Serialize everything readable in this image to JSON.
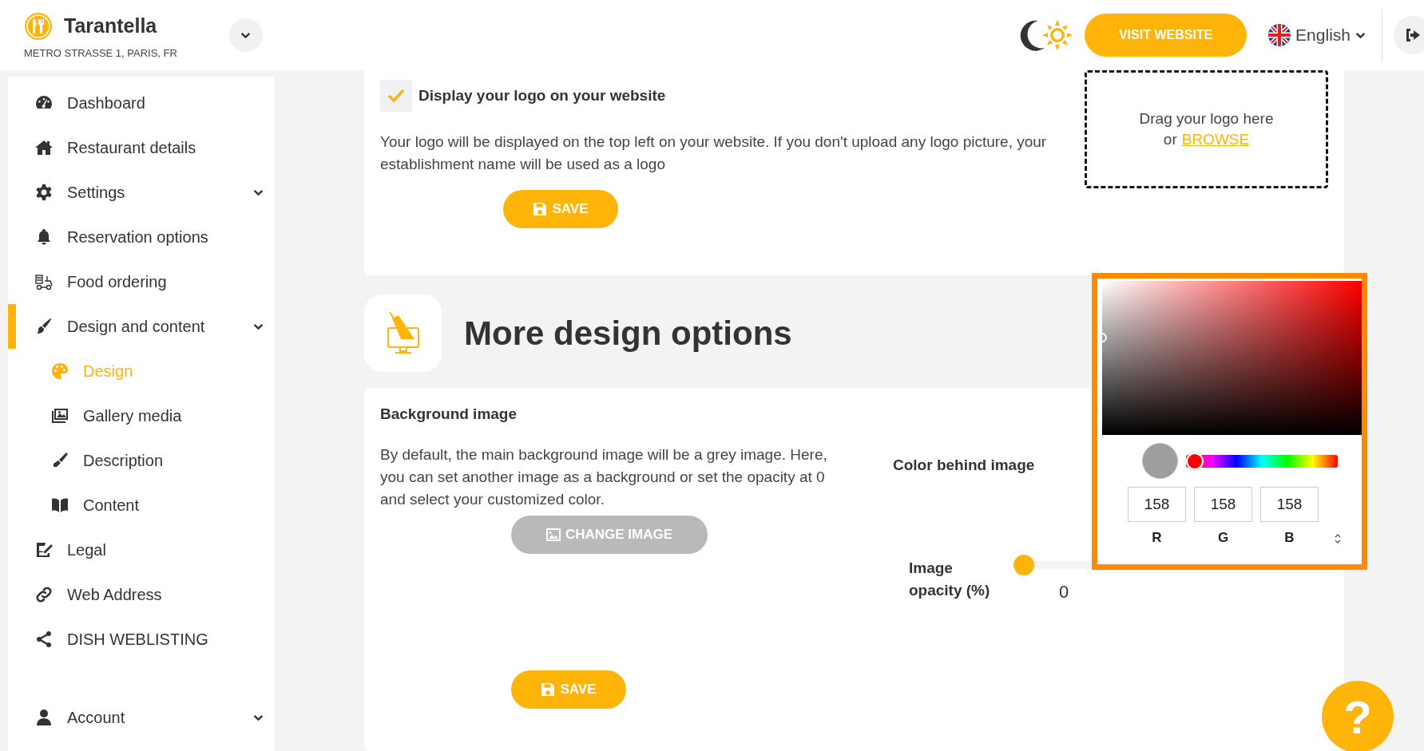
{
  "header": {
    "brand": {
      "name": "Tarantella",
      "address": "METRO STRASSE 1, PARIS, FR"
    },
    "visit_button": "VISIT WEBSITE",
    "language": "English"
  },
  "sidebar": {
    "items": [
      {
        "label": "Dashboard",
        "kind": "link",
        "selected": false
      },
      {
        "label": "Restaurant details",
        "kind": "link",
        "selected": false
      },
      {
        "label": "Settings",
        "kind": "group",
        "selected": false
      },
      {
        "label": "Reservation options",
        "kind": "link",
        "selected": false
      },
      {
        "label": "Food ordering",
        "kind": "link",
        "selected": false
      },
      {
        "label": "Design and content",
        "kind": "group",
        "selected": false,
        "children": [
          {
            "label": "Design",
            "selected": true
          },
          {
            "label": "Gallery media",
            "selected": false
          },
          {
            "label": "Description",
            "selected": false
          },
          {
            "label": "Content",
            "selected": false
          }
        ]
      },
      {
        "label": "Legal",
        "kind": "link",
        "selected": false
      },
      {
        "label": "Web Address",
        "kind": "link",
        "selected": false
      },
      {
        "label": "DISH WEBLISTING",
        "kind": "link",
        "selected": false
      }
    ],
    "footer_item": {
      "label": "Account",
      "kind": "group",
      "selected": false
    }
  },
  "logo_card": {
    "checkbox": {
      "label": "Display your logo on your website",
      "checked": true
    },
    "description": "Your logo will be displayed on the top left on your website. If you don't upload any logo picture, your establishment name will be used as a logo",
    "save_button": "SAVE",
    "dropzone": {
      "text": "Drag your logo here",
      "or": "or",
      "browse": "BROWSE"
    }
  },
  "section": {
    "title": "More design options"
  },
  "background_card": {
    "title": "Background image",
    "description": "By default, the main background image will be a grey image. Here, you can set another image as a background or set the opacity at 0 and select your customized color.",
    "change_button": {
      "label": "CHANGE IMAGE",
      "disabled": true
    },
    "color_label": "Color behind image",
    "opacity": {
      "label": "Image opacity (%)",
      "level": 0,
      "reading": "0"
    },
    "save_button": "SAVE"
  },
  "color_picker": {
    "hue": {
      "level": 0
    },
    "channels": [
      {
        "label": "R",
        "value": "158"
      },
      {
        "label": "G",
        "value": "158"
      },
      {
        "label": "B",
        "value": "158"
      }
    ]
  },
  "help_button": "?"
}
